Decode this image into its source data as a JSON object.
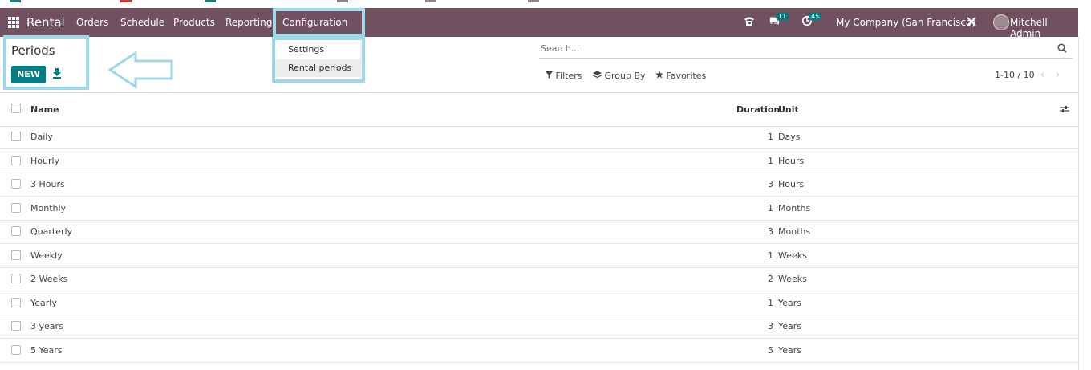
{
  "navbar": {
    "brand": "Rental",
    "menus": [
      "Orders",
      "Schedule",
      "Products",
      "Reporting",
      "Configuration"
    ],
    "chat_badge": "11",
    "activity_badge": "45",
    "company": "My Company (San Francisco)",
    "user": "Mitchell Admin"
  },
  "dropdown": {
    "items": [
      "Settings",
      "Rental periods"
    ]
  },
  "page": {
    "title": "Periods",
    "new_label": "NEW"
  },
  "search": {
    "placeholder": "Search..."
  },
  "filters": {
    "filters_label": "Filters",
    "groupby_label": "Group By",
    "favorites_label": "Favorites"
  },
  "pager": {
    "range": "1-10 / 10"
  },
  "table": {
    "columns": [
      "Name",
      "Duration",
      "Unit"
    ],
    "rows": [
      {
        "name": "Daily",
        "duration": "1",
        "unit": "Days"
      },
      {
        "name": "Hourly",
        "duration": "1",
        "unit": "Hours"
      },
      {
        "name": "3 Hours",
        "duration": "3",
        "unit": "Hours"
      },
      {
        "name": "Monthly",
        "duration": "1",
        "unit": "Months"
      },
      {
        "name": "Quarterly",
        "duration": "3",
        "unit": "Months"
      },
      {
        "name": "Weekly",
        "duration": "1",
        "unit": "Weeks"
      },
      {
        "name": "2 Weeks",
        "duration": "2",
        "unit": "Weeks"
      },
      {
        "name": "Yearly",
        "duration": "1",
        "unit": "Years"
      },
      {
        "name": "3 years",
        "duration": "3",
        "unit": "Years"
      },
      {
        "name": "5 Years",
        "duration": "5",
        "unit": "Years"
      }
    ]
  },
  "colors": {
    "navbar": "#71505f",
    "primary": "#017e84",
    "highlight": "#9fd7e6"
  }
}
